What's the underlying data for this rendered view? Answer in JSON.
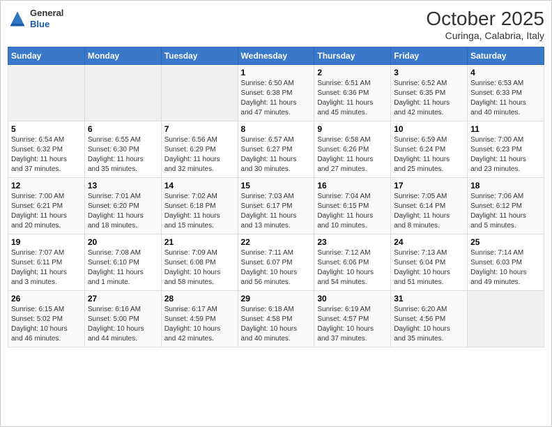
{
  "header": {
    "logo_general": "General",
    "logo_blue": "Blue",
    "title": "October 2025",
    "subtitle": "Curinga, Calabria, Italy"
  },
  "weekdays": [
    "Sunday",
    "Monday",
    "Tuesday",
    "Wednesday",
    "Thursday",
    "Friday",
    "Saturday"
  ],
  "weeks": [
    [
      {
        "day": "",
        "info": ""
      },
      {
        "day": "",
        "info": ""
      },
      {
        "day": "",
        "info": ""
      },
      {
        "day": "1",
        "info": "Sunrise: 6:50 AM\nSunset: 6:38 PM\nDaylight: 11 hours\nand 47 minutes."
      },
      {
        "day": "2",
        "info": "Sunrise: 6:51 AM\nSunset: 6:36 PM\nDaylight: 11 hours\nand 45 minutes."
      },
      {
        "day": "3",
        "info": "Sunrise: 6:52 AM\nSunset: 6:35 PM\nDaylight: 11 hours\nand 42 minutes."
      },
      {
        "day": "4",
        "info": "Sunrise: 6:53 AM\nSunset: 6:33 PM\nDaylight: 11 hours\nand 40 minutes."
      }
    ],
    [
      {
        "day": "5",
        "info": "Sunrise: 6:54 AM\nSunset: 6:32 PM\nDaylight: 11 hours\nand 37 minutes."
      },
      {
        "day": "6",
        "info": "Sunrise: 6:55 AM\nSunset: 6:30 PM\nDaylight: 11 hours\nand 35 minutes."
      },
      {
        "day": "7",
        "info": "Sunrise: 6:56 AM\nSunset: 6:29 PM\nDaylight: 11 hours\nand 32 minutes."
      },
      {
        "day": "8",
        "info": "Sunrise: 6:57 AM\nSunset: 6:27 PM\nDaylight: 11 hours\nand 30 minutes."
      },
      {
        "day": "9",
        "info": "Sunrise: 6:58 AM\nSunset: 6:26 PM\nDaylight: 11 hours\nand 27 minutes."
      },
      {
        "day": "10",
        "info": "Sunrise: 6:59 AM\nSunset: 6:24 PM\nDaylight: 11 hours\nand 25 minutes."
      },
      {
        "day": "11",
        "info": "Sunrise: 7:00 AM\nSunset: 6:23 PM\nDaylight: 11 hours\nand 23 minutes."
      }
    ],
    [
      {
        "day": "12",
        "info": "Sunrise: 7:00 AM\nSunset: 6:21 PM\nDaylight: 11 hours\nand 20 minutes."
      },
      {
        "day": "13",
        "info": "Sunrise: 7:01 AM\nSunset: 6:20 PM\nDaylight: 11 hours\nand 18 minutes."
      },
      {
        "day": "14",
        "info": "Sunrise: 7:02 AM\nSunset: 6:18 PM\nDaylight: 11 hours\nand 15 minutes."
      },
      {
        "day": "15",
        "info": "Sunrise: 7:03 AM\nSunset: 6:17 PM\nDaylight: 11 hours\nand 13 minutes."
      },
      {
        "day": "16",
        "info": "Sunrise: 7:04 AM\nSunset: 6:15 PM\nDaylight: 11 hours\nand 10 minutes."
      },
      {
        "day": "17",
        "info": "Sunrise: 7:05 AM\nSunset: 6:14 PM\nDaylight: 11 hours\nand 8 minutes."
      },
      {
        "day": "18",
        "info": "Sunrise: 7:06 AM\nSunset: 6:12 PM\nDaylight: 11 hours\nand 5 minutes."
      }
    ],
    [
      {
        "day": "19",
        "info": "Sunrise: 7:07 AM\nSunset: 6:11 PM\nDaylight: 11 hours\nand 3 minutes."
      },
      {
        "day": "20",
        "info": "Sunrise: 7:08 AM\nSunset: 6:10 PM\nDaylight: 11 hours\nand 1 minute."
      },
      {
        "day": "21",
        "info": "Sunrise: 7:09 AM\nSunset: 6:08 PM\nDaylight: 10 hours\nand 58 minutes."
      },
      {
        "day": "22",
        "info": "Sunrise: 7:11 AM\nSunset: 6:07 PM\nDaylight: 10 hours\nand 56 minutes."
      },
      {
        "day": "23",
        "info": "Sunrise: 7:12 AM\nSunset: 6:06 PM\nDaylight: 10 hours\nand 54 minutes."
      },
      {
        "day": "24",
        "info": "Sunrise: 7:13 AM\nSunset: 6:04 PM\nDaylight: 10 hours\nand 51 minutes."
      },
      {
        "day": "25",
        "info": "Sunrise: 7:14 AM\nSunset: 6:03 PM\nDaylight: 10 hours\nand 49 minutes."
      }
    ],
    [
      {
        "day": "26",
        "info": "Sunrise: 6:15 AM\nSunset: 5:02 PM\nDaylight: 10 hours\nand 46 minutes."
      },
      {
        "day": "27",
        "info": "Sunrise: 6:16 AM\nSunset: 5:00 PM\nDaylight: 10 hours\nand 44 minutes."
      },
      {
        "day": "28",
        "info": "Sunrise: 6:17 AM\nSunset: 4:59 PM\nDaylight: 10 hours\nand 42 minutes."
      },
      {
        "day": "29",
        "info": "Sunrise: 6:18 AM\nSunset: 4:58 PM\nDaylight: 10 hours\nand 40 minutes."
      },
      {
        "day": "30",
        "info": "Sunrise: 6:19 AM\nSunset: 4:57 PM\nDaylight: 10 hours\nand 37 minutes."
      },
      {
        "day": "31",
        "info": "Sunrise: 6:20 AM\nSunset: 4:56 PM\nDaylight: 10 hours\nand 35 minutes."
      },
      {
        "day": "",
        "info": ""
      }
    ]
  ]
}
